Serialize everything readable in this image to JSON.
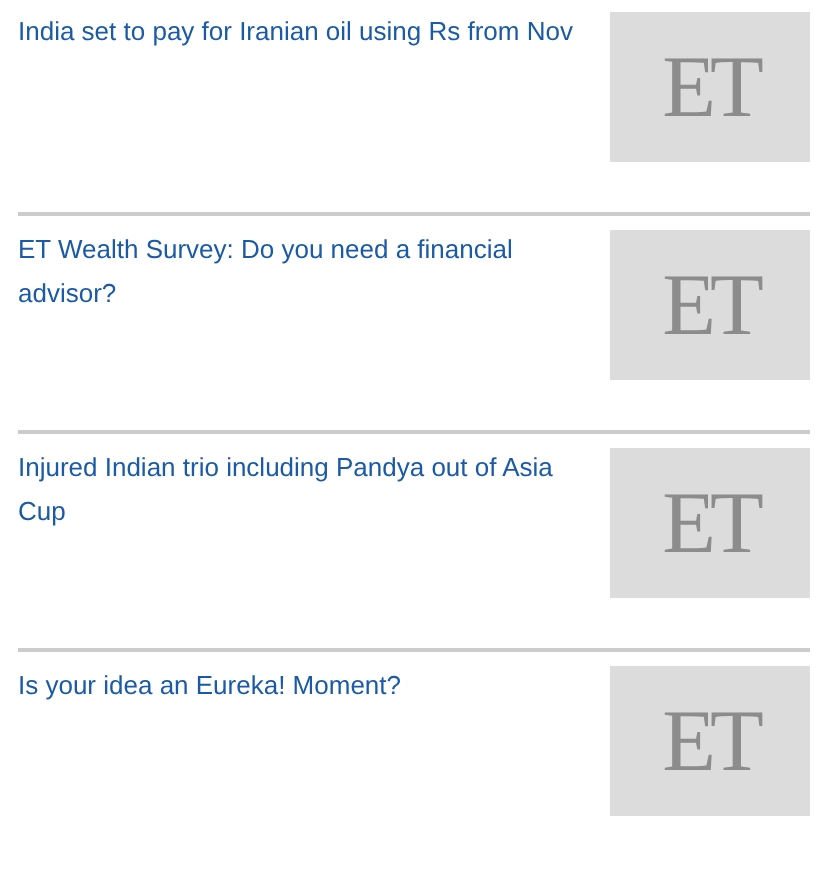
{
  "articles": [
    {
      "title": "India set to pay for Iranian oil using Rs from Nov",
      "thumbnail_text": "ET"
    },
    {
      "title": "ET Wealth Survey: Do you need a financial advisor?",
      "thumbnail_text": "ET"
    },
    {
      "title": "Injured Indian trio including Pandya out of Asia Cup",
      "thumbnail_text": "ET"
    },
    {
      "title": "Is your idea an Eureka! Moment?",
      "thumbnail_text": "ET"
    }
  ]
}
